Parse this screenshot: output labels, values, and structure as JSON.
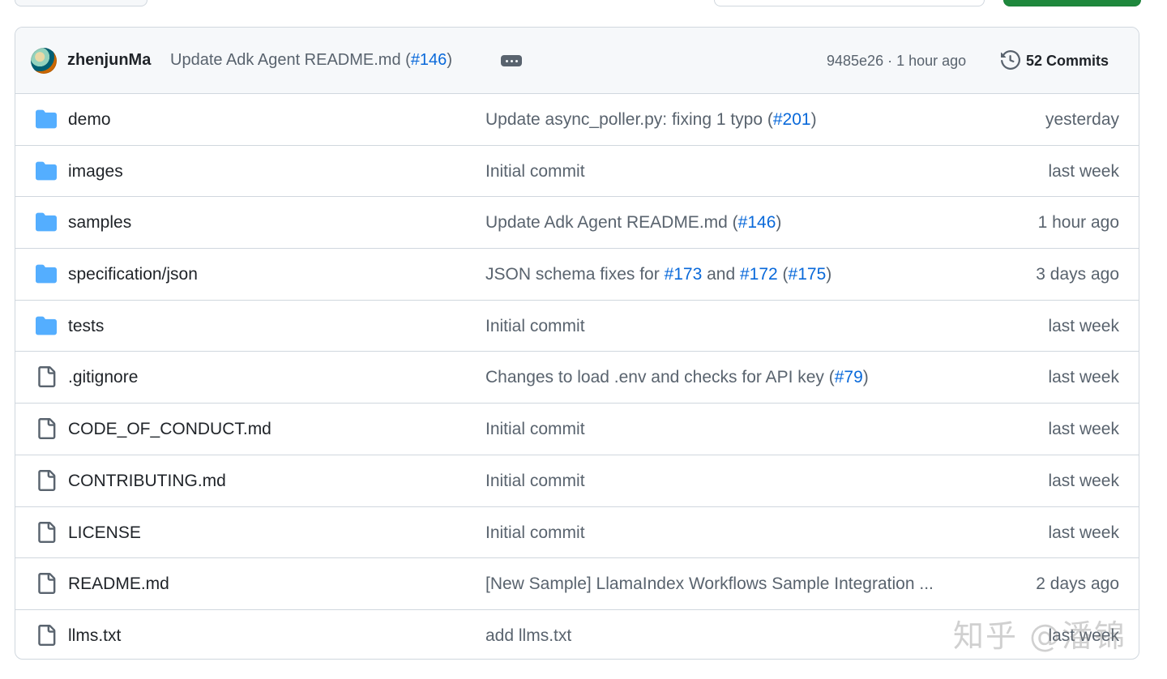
{
  "latest_commit": {
    "author": "zhenjunMa",
    "message_prefix": "Update Adk Agent README.md (",
    "message_link": "#146",
    "message_suffix": ")",
    "hash": "9485e26",
    "separator": " · ",
    "time": "1 hour ago",
    "commits_label": "52 Commits"
  },
  "files": [
    {
      "type": "folder",
      "name": "demo",
      "msg": [
        {
          "t": "Update async_poller.py: fixing 1 typo ("
        },
        {
          "t": "#201",
          "link": true
        },
        {
          "t": ")"
        }
      ],
      "time": "yesterday"
    },
    {
      "type": "folder",
      "name": "images",
      "msg": [
        {
          "t": "Initial commit"
        }
      ],
      "time": "last week"
    },
    {
      "type": "folder",
      "name": "samples",
      "msg": [
        {
          "t": "Update Adk Agent README.md ("
        },
        {
          "t": "#146",
          "link": true
        },
        {
          "t": ")"
        }
      ],
      "time": "1 hour ago"
    },
    {
      "type": "folder",
      "name": "specification/json",
      "msg": [
        {
          "t": "JSON schema fixes for "
        },
        {
          "t": "#173",
          "link": true
        },
        {
          "t": " and "
        },
        {
          "t": "#172",
          "link": true
        },
        {
          "t": " ("
        },
        {
          "t": "#175",
          "link": true
        },
        {
          "t": ")"
        }
      ],
      "time": "3 days ago"
    },
    {
      "type": "folder",
      "name": "tests",
      "msg": [
        {
          "t": "Initial commit"
        }
      ],
      "time": "last week"
    },
    {
      "type": "file",
      "name": ".gitignore",
      "msg": [
        {
          "t": "Changes to load .env and checks for API key ("
        },
        {
          "t": "#79",
          "link": true
        },
        {
          "t": ")"
        }
      ],
      "time": "last week"
    },
    {
      "type": "file",
      "name": "CODE_OF_CONDUCT.md",
      "msg": [
        {
          "t": "Initial commit"
        }
      ],
      "time": "last week"
    },
    {
      "type": "file",
      "name": "CONTRIBUTING.md",
      "msg": [
        {
          "t": "Initial commit"
        }
      ],
      "time": "last week"
    },
    {
      "type": "file",
      "name": "LICENSE",
      "msg": [
        {
          "t": "Initial commit"
        }
      ],
      "time": "last week"
    },
    {
      "type": "file",
      "name": "README.md",
      "msg": [
        {
          "t": "[New Sample] LlamaIndex Workflows Sample Integration ..."
        }
      ],
      "time": "2 days ago"
    },
    {
      "type": "file",
      "name": "llms.txt",
      "msg": [
        {
          "t": "add llms.txt"
        }
      ],
      "time": "last week"
    }
  ],
  "watermark": "知乎 @潘锦",
  "colors": {
    "link": "#0969da",
    "folder": "#54aeff",
    "muted": "#59636e",
    "border": "#d0d7de"
  }
}
